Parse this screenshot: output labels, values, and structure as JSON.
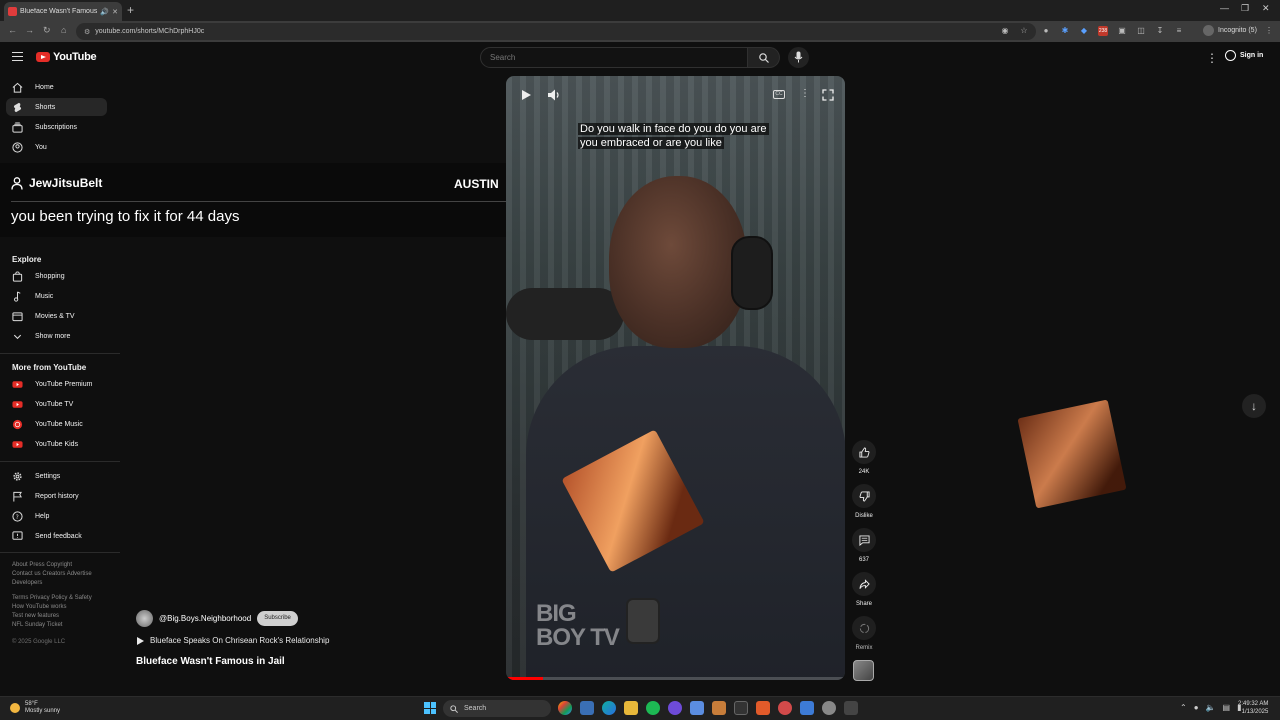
{
  "browser": {
    "tab_title": "Blueface Wasn't Famous in Jail",
    "url": "youtube.com/shorts/MChDrphHJ0c",
    "profile_label": "Incognito (5)",
    "extension_badge": "238"
  },
  "header": {
    "logo_text": "YouTube",
    "search_placeholder": "Search",
    "sign_in_label": "Sign in"
  },
  "sidebar": {
    "main_items": [
      {
        "label": "Home",
        "icon": "home-icon"
      },
      {
        "label": "Shorts",
        "icon": "shorts-icon",
        "active": true
      },
      {
        "label": "Subscriptions",
        "icon": "subscriptions-icon"
      },
      {
        "label": "You",
        "icon": "you-icon"
      }
    ],
    "explore_heading": "Explore",
    "explore_items": [
      {
        "label": "Shopping",
        "icon": "shopping-icon"
      },
      {
        "label": "Music",
        "icon": "music-icon"
      },
      {
        "label": "Movies & TV",
        "icon": "movies-icon"
      },
      {
        "label": "Show more",
        "icon": "chevron-down-icon"
      }
    ],
    "more_heading": "More from YouTube",
    "more_items": [
      {
        "label": "YouTube Premium"
      },
      {
        "label": "YouTube TV"
      },
      {
        "label": "YouTube Music"
      },
      {
        "label": "YouTube Kids"
      }
    ],
    "settings_items": [
      {
        "label": "Settings",
        "icon": "gear-icon"
      },
      {
        "label": "Report history",
        "icon": "flag-icon"
      },
      {
        "label": "Help",
        "icon": "help-icon"
      },
      {
        "label": "Send feedback",
        "icon": "feedback-icon"
      }
    ],
    "footer_links_1": "About  Press  Copyright\nContact us  Creators  Advertise\nDevelopers",
    "footer_links_2": "Terms  Privacy  Policy & Safety\nHow YouTube works\nTest new features\nNFL Sunday Ticket",
    "copyright": "© 2025 Google LLC"
  },
  "overlay": {
    "username": "JewJitsuBelt",
    "streamer": "AUSTIN",
    "message": "you been trying to fix it for 44 days"
  },
  "player": {
    "caption_line1": "Do you walk in face do you do you are",
    "caption_line2": "you embraced or are you like",
    "watermark_line1": "BIG",
    "watermark_line2": "BOY TV",
    "progress_fraction": 0.11
  },
  "actions": {
    "like_count": "24K",
    "dislike_label": "Dislike",
    "comments_count": "637",
    "share_label": "Share",
    "remix_label": "Remix"
  },
  "video": {
    "channel": "@Big.Boys.Neighborhood",
    "subscribe_label": "Subscribe",
    "related_title": "Blueface Speaks On Chrisean Rock's Relationship",
    "title": "Blueface Wasn't Famous in Jail"
  },
  "taskbar": {
    "temp": "58°F",
    "weather": "Mostly sunny",
    "search_label": "Search",
    "time": "2:49:32 AM",
    "date": "1/13/2025"
  },
  "colors": {
    "brand_red": "#e52d27",
    "background": "#0f0f0f",
    "windows_accent": "#4cc2ff"
  }
}
